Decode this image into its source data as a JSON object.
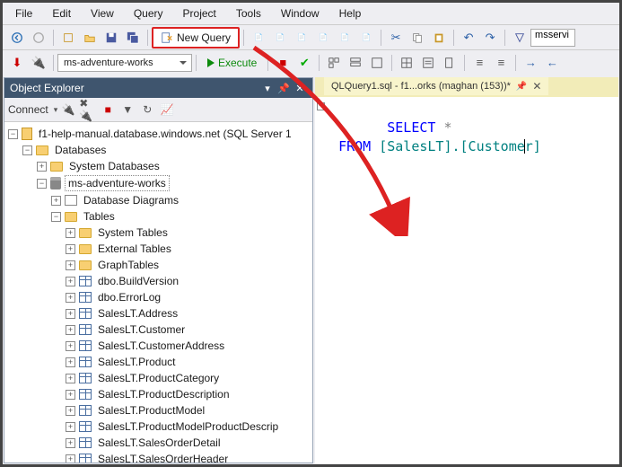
{
  "menu": [
    "File",
    "Edit",
    "View",
    "Query",
    "Project",
    "Tools",
    "Window",
    "Help"
  ],
  "toolbar1": {
    "new_query_label": "New Query",
    "search_box": "msservi"
  },
  "toolbar2": {
    "db_combo": "ms-adventure-works",
    "execute_label": "Execute"
  },
  "object_explorer": {
    "title": "Object Explorer",
    "connect_label": "Connect",
    "server": "f1-help-manual.database.windows.net (SQL Server 1",
    "nodes": {
      "databases": "Databases",
      "sysdb": "System Databases",
      "userdb": "ms-adventure-works",
      "diagrams": "Database Diagrams",
      "tables": "Tables",
      "systables": "System Tables",
      "exttables": "External Tables",
      "graphtables": "GraphTables",
      "t1": "dbo.BuildVersion",
      "t2": "dbo.ErrorLog",
      "t3": "SalesLT.Address",
      "t4": "SalesLT.Customer",
      "t5": "SalesLT.CustomerAddress",
      "t6": "SalesLT.Product",
      "t7": "SalesLT.ProductCategory",
      "t8": "SalesLT.ProductDescription",
      "t9": "SalesLT.ProductModel",
      "t10": "SalesLT.ProductModelProductDescrip",
      "t11": "SalesLT.SalesOrderDetail",
      "t12": "SalesLT.SalesOrderHeader"
    }
  },
  "editor": {
    "tab_label": "QLQuery1.sql - f1...orks (maghan (153))*",
    "code": {
      "select": "SELECT",
      "star": "*",
      "from": "FROM",
      "obj_pre": "[SalesLT].[Custome",
      "obj_post": "r]"
    }
  }
}
